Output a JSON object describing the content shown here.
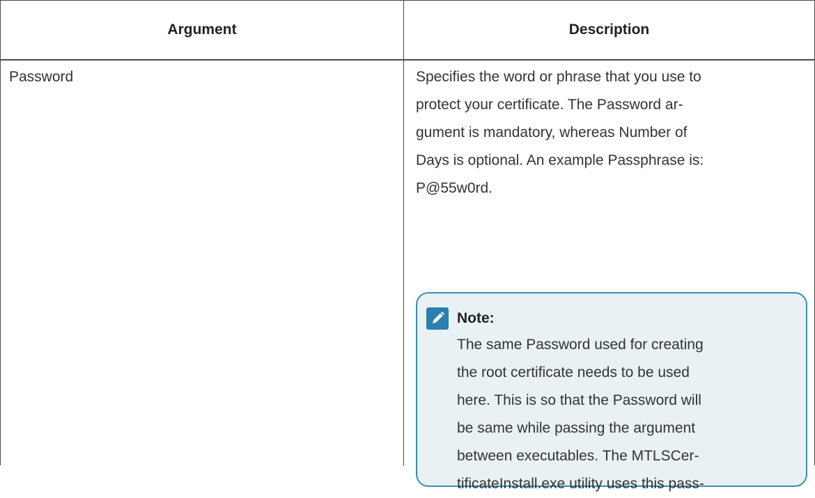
{
  "table": {
    "headers": {
      "argument": "Argument",
      "description": "Description"
    },
    "rows": [
      {
        "argument": "Password",
        "description_lines": [
          "Specifies the word or phrase that you use to",
          "protect your certificate. The Password ar-",
          "gument is mandatory, whereas Number of",
          "Days is optional. An example Passphrase is:",
          "P@55w0rd."
        ],
        "note": {
          "icon": "pencil-note-icon",
          "title": "Note:",
          "lines": [
            "The same Password used for creating",
            "the root certificate needs to be used",
            "here. This is so that the Password will",
            "be same while passing the argument",
            "between executables. The MTLSCer-",
            "tificateInstall.exe utility uses this pass-"
          ]
        }
      }
    ]
  },
  "colors": {
    "note_border": "#3a8cb0",
    "note_background": "#e9f1f4",
    "note_icon": "#2a7fae"
  }
}
